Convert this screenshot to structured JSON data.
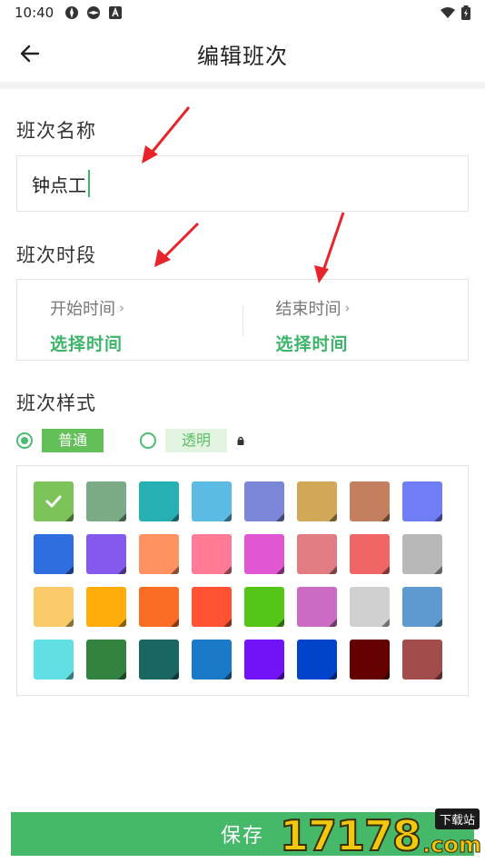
{
  "status_bar": {
    "time": "10:40"
  },
  "header": {
    "title": "编辑班次"
  },
  "shift_name": {
    "label": "班次名称",
    "value": "钟点工"
  },
  "shift_period": {
    "label": "班次时段",
    "start": {
      "label": "开始时间",
      "chevron": "›",
      "value": "选择时间"
    },
    "end": {
      "label": "结束时间",
      "chevron": "›",
      "value": "选择时间"
    }
  },
  "shift_style": {
    "label": "班次样式",
    "options": [
      {
        "label": "普通",
        "selected": true
      },
      {
        "label": "透明",
        "selected": false,
        "locked": true
      }
    ]
  },
  "palette": {
    "selected_index": 0,
    "colors": [
      "#7cc45a",
      "#7aab85",
      "#26b0b3",
      "#5cbbe3",
      "#7b86d8",
      "#d1a758",
      "#c47f5f",
      "#6f7ef7",
      "#2f6ee0",
      "#8559ed",
      "#ff9260",
      "#ff7a95",
      "#e157d2",
      "#e07c82",
      "#f06565",
      "#b8b8b8",
      "#f9cb68",
      "#ffad0a",
      "#fb6c24",
      "#ff5232",
      "#55c518",
      "#cc6bc3",
      "#d0d0d0",
      "#5d9ad0",
      "#62dfe4",
      "#31833f",
      "#186762",
      "#1a7ac8",
      "#7112f7",
      "#0143cb",
      "#650000",
      "#a24d4b"
    ]
  },
  "save_button": {
    "label": "保存"
  },
  "watermark": {
    "number": "17178",
    "tag": "下载站",
    "domain": ".com"
  },
  "theme": {
    "accent": "#3cb56a",
    "arrow": "#e8242a"
  }
}
